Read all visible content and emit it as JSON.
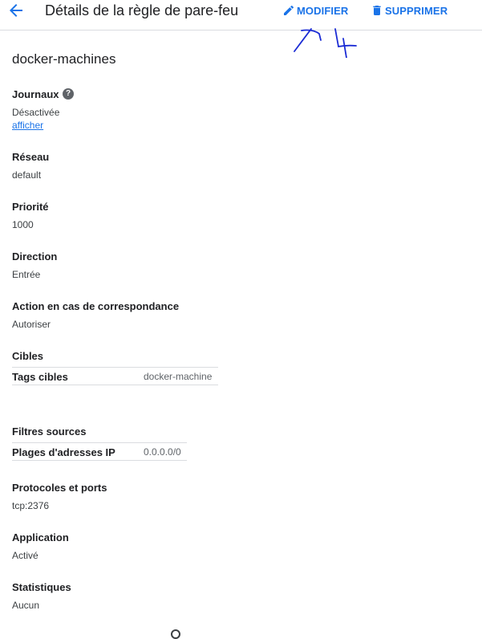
{
  "header": {
    "title": "Détails de la règle de pare-feu",
    "edit_label": "MODIFIER",
    "delete_label": "SUPPRIMER",
    "accent_color": "#1a73e8"
  },
  "rule": {
    "name": "docker-machines"
  },
  "logs": {
    "label": "Journaux",
    "value": "Désactivée",
    "link": "afficher",
    "help_icon": "help-icon"
  },
  "network": {
    "label": "Réseau",
    "value": "default"
  },
  "priority": {
    "label": "Priorité",
    "value": "1000"
  },
  "direction": {
    "label": "Direction",
    "value": "Entrée"
  },
  "action": {
    "label": "Action en cas de correspondance",
    "value": "Autoriser"
  },
  "targets": {
    "label": "Cibles",
    "key": "Tags cibles",
    "value": "docker-machine"
  },
  "source_filters": {
    "label": "Filtres sources",
    "key": "Plages d'adresses IP",
    "value": "0.0.0.0/0"
  },
  "protocols": {
    "label": "Protocoles et ports",
    "value": "tcp:2376"
  },
  "enforcement": {
    "label": "Application",
    "value": "Activé"
  },
  "statistics": {
    "label": "Statistiques",
    "value": "Aucun"
  }
}
